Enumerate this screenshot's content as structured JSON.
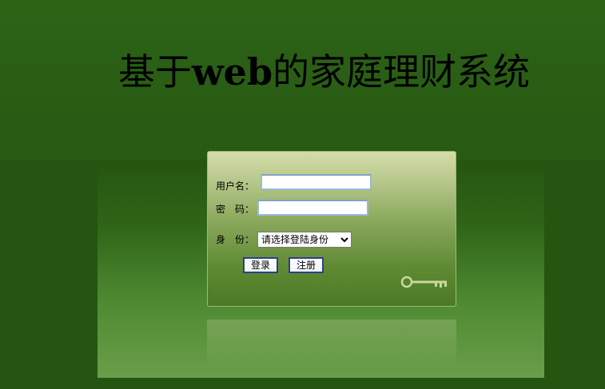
{
  "page": {
    "title_prefix": "基于",
    "title_latin": "web",
    "title_suffix": "的家庭理财系统"
  },
  "login": {
    "username_label": "用户名：",
    "username_value": "",
    "password_label": "密　码：",
    "password_value": "",
    "role_label": "身　份：",
    "role_selected": "请选择登陆身份",
    "login_button": "登录",
    "register_button": "注册"
  },
  "icons": {
    "decoration": "key-icon",
    "select_arrow": "chevron-down-icon"
  },
  "colors": {
    "background": "#255511",
    "panel_top": "#d5dcaa",
    "panel_bottom": "#4b7a24",
    "button_border": "#2c3f8a"
  }
}
